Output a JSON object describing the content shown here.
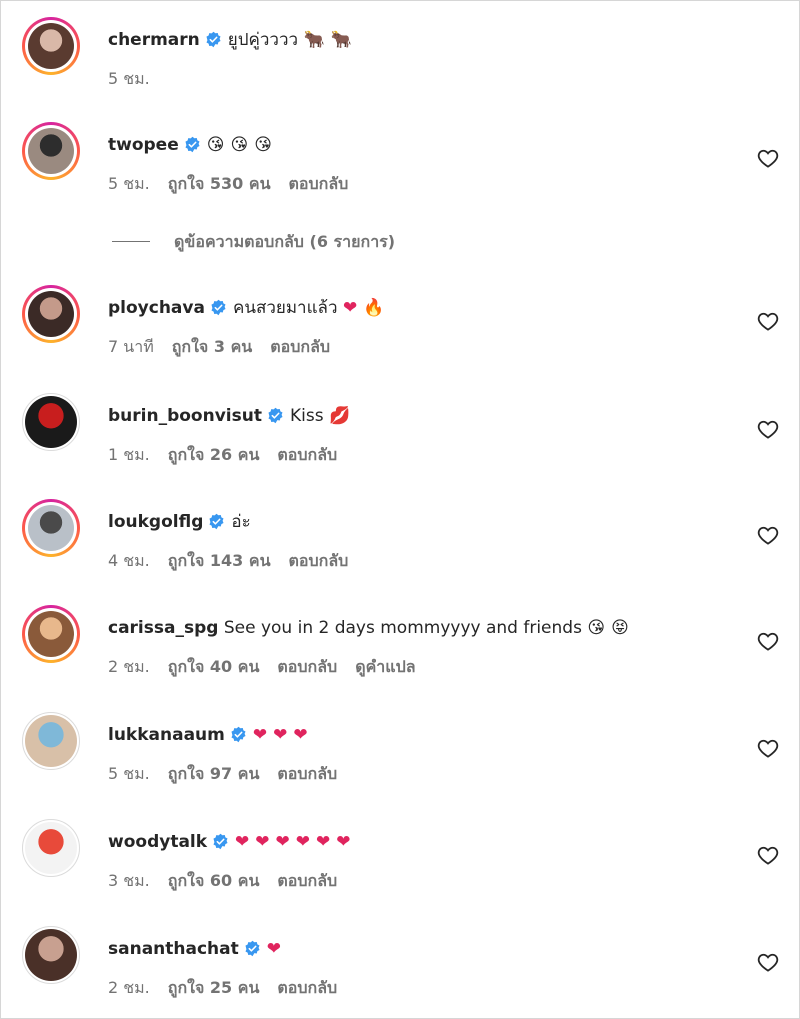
{
  "colors": {
    "verified": "#3897f0",
    "muted": "#737373",
    "text": "#262626",
    "heart": "#e0245e"
  },
  "icons": {
    "verified": "verified-badge-icon",
    "like": "heart-outline-icon"
  },
  "view_replies_label": "ดูข้อความตอบกลับ (6 รายการ)",
  "comments": [
    {
      "user": "chermarn",
      "verified": true,
      "text": "ยูปคู่วววว",
      "emoji": [
        "🐂",
        "🐂"
      ],
      "time": "5 ชม.",
      "likes": "",
      "reply": "",
      "translate": ""
    },
    {
      "user": "twopee",
      "verified": true,
      "text": "",
      "emoji": [
        "😘",
        "😘",
        "😘"
      ],
      "time": "5 ชม.",
      "likes": "ถูกใจ 530 คน",
      "reply": "ตอบกลับ",
      "translate": ""
    },
    {
      "user": "ploychava",
      "verified": true,
      "text": "คนสวยมาแล้ว",
      "emoji": [
        "❤️",
        "🔥"
      ],
      "time": "7 นาที",
      "likes": "ถูกใจ 3 คน",
      "reply": "ตอบกลับ",
      "translate": ""
    },
    {
      "user": "burin_boonvisut",
      "verified": true,
      "text": "Kiss",
      "emoji": [
        "💋"
      ],
      "time": "1 ชม.",
      "likes": "ถูกใจ 26 คน",
      "reply": "ตอบกลับ",
      "translate": ""
    },
    {
      "user": "loukgolflg",
      "verified": true,
      "text": "อ่ะ",
      "emoji": [],
      "time": "4 ชม.",
      "likes": "ถูกใจ 143 คน",
      "reply": "ตอบกลับ",
      "translate": ""
    },
    {
      "user": "carissa_spg",
      "verified": false,
      "text": "See you in 2 days mommyyyy and friends",
      "emoji": [
        "😘",
        "😝"
      ],
      "time": "2 ชม.",
      "likes": "ถูกใจ 40 คน",
      "reply": "ตอบกลับ",
      "translate": "ดูคำแปล"
    },
    {
      "user": "lukkanaaum",
      "verified": true,
      "text": "",
      "emoji": [
        "❤️",
        "❤️",
        "❤️"
      ],
      "time": "5 ชม.",
      "likes": "ถูกใจ 97 คน",
      "reply": "ตอบกลับ",
      "translate": ""
    },
    {
      "user": "woodytalk",
      "verified": true,
      "text": "",
      "emoji": [
        "❤️",
        "❤️",
        "❤️",
        "❤️",
        "❤️",
        "❤️"
      ],
      "time": "3 ชม.",
      "likes": "ถูกใจ 60 คน",
      "reply": "ตอบกลับ",
      "translate": ""
    },
    {
      "user": "sananthachat",
      "verified": true,
      "text": "",
      "emoji": [
        "❤️"
      ],
      "time": "2 ชม.",
      "likes": "ถูกใจ 25 คน",
      "reply": "ตอบกลับ",
      "translate": ""
    }
  ]
}
